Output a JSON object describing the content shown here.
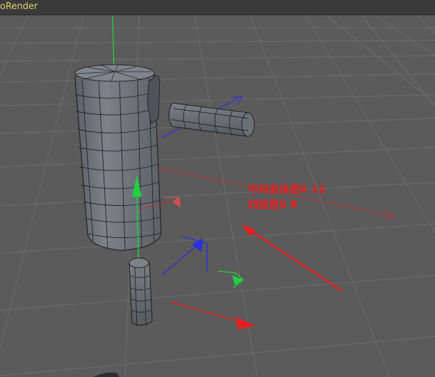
{
  "window": {
    "title": "oRender"
  },
  "annotation": {
    "line1": "中间身体是6 12",
    "line2": "四肢是6 8"
  },
  "colors": {
    "viewport_bg": "#5b5b5b",
    "grid_line": "#6e6e6e",
    "mesh_fill": "#6d737b",
    "mesh_edge": "#222222",
    "axis_x": "#e02020",
    "axis_y": "#20d040",
    "axis_z": "#2830e0",
    "annotation": "#e61e1e",
    "title_text": "#e6d06a"
  },
  "icons": [
    "move-gizmo-icon",
    "rotate-handle-icon",
    "scale-handle-icon"
  ]
}
